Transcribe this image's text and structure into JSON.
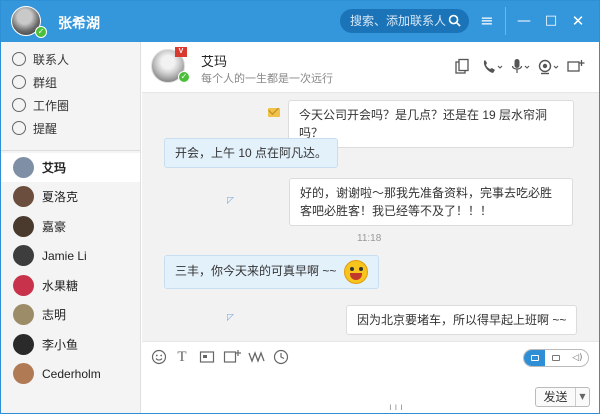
{
  "titlebar": {
    "user_name": "张希湖",
    "search_placeholder": "搜索、添加联系人",
    "colors": {
      "bar": "#3496db"
    }
  },
  "sidebar": {
    "nav": [
      {
        "label": "联系人",
        "icon": "contacts-icon"
      },
      {
        "label": "群组",
        "icon": "group-icon"
      },
      {
        "label": "工作圈",
        "icon": "workcircle-icon"
      },
      {
        "label": "提醒",
        "icon": "reminder-icon"
      }
    ],
    "contacts": [
      {
        "name": "艾玛",
        "active": true,
        "color": "#7f8fa6"
      },
      {
        "name": "夏洛克",
        "active": false,
        "color": "#6b4e3d"
      },
      {
        "name": "嘉豪",
        "active": false,
        "color": "#4a3a2e"
      },
      {
        "name": "Jamie Li",
        "active": false,
        "color": "#3d3d3d"
      },
      {
        "name": "水果糖",
        "active": false,
        "color": "#c8334b"
      },
      {
        "name": "志明",
        "active": false,
        "color": "#9c8c68"
      },
      {
        "name": "李小鱼",
        "active": false,
        "color": "#2a2a2a"
      },
      {
        "name": "Cederholm",
        "active": false,
        "color": "#b07a54"
      }
    ]
  },
  "chat": {
    "peer_name": "艾玛",
    "peer_signature": "每个人的一生都是一次远行",
    "peer_badge": "V",
    "messages": [
      {
        "side": "right",
        "text": "今天公司开会吗？是几点？还是在 19 层水帘洞吗？"
      },
      {
        "side": "left",
        "text": "开会，上午 10 点在阿凡达。"
      },
      {
        "side": "right",
        "text": "好的，谢谢啦～那我先准备资料，完事去吃必胜客吧必胜客！我已经等不及了！！！"
      },
      {
        "side": "left",
        "text": "三丰，你今天来的可真早啊 ~~"
      },
      {
        "side": "right",
        "text": "因为北京要堵车，所以得早起上班啊 ~~"
      }
    ],
    "time_label": "11:18"
  },
  "input": {
    "send_label": "发送"
  }
}
